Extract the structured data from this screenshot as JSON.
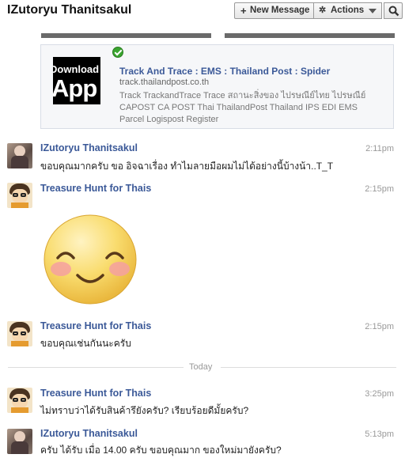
{
  "header": {
    "title": "IZutoryu Thanitsakul",
    "new_message_label": "New Message",
    "new_message_icon": "plus-icon",
    "actions_label": "Actions",
    "actions_icon": "gear-icon",
    "search_icon": "search-icon"
  },
  "attachment": {
    "thumb_line1": "Download",
    "thumb_line2": "App S",
    "title": "Track And Trace : EMS : Thailand Post : Spider",
    "url": "track.thailandpost.co.th",
    "description": "Track TrackandTrace Trace สถานะสิ่งของ ไปรษณีย์ไทย ไปรษณีย์ CAPOST CA POST Thai ThailandPost Thailand IPS EDI EMS Parcel Logispost Register"
  },
  "messages": [
    {
      "sender": "IZutoryu Thanitsakul",
      "time": "2:11pm",
      "text": "ขอบคุณมากครับ ขอ อิจฉาเรื่อง ทำไมลายมือผมไม่ได้อย่างนี้บ้างน้า..T_T"
    },
    {
      "sender": "Treasure Hunt for Thais",
      "time": "2:15pm",
      "text": ""
    },
    {
      "sender": "Treasure Hunt for Thais",
      "time": "2:15pm",
      "text": "ขอบคุณเช่นกันนะครับ"
    },
    {
      "sender": "Treasure Hunt for Thais",
      "time": "3:25pm",
      "text": "ไม่ทราบว่าได้รับสินค้ารึยังครับ? เรียบร้อยดีมั้ยครับ?"
    },
    {
      "sender": "IZutoryu Thanitsakul",
      "time": "5:13pm",
      "text": "ครับ ได้รับ เมื่อ 14.00 ครับ ขอบคุณมาก ของใหม่มายังครับ?"
    }
  ],
  "divider": {
    "label": "Today"
  },
  "colors": {
    "link_blue": "#3b5998",
    "sticker_face": "#f7d25a",
    "sticker_cheek": "#f4a0a0"
  }
}
